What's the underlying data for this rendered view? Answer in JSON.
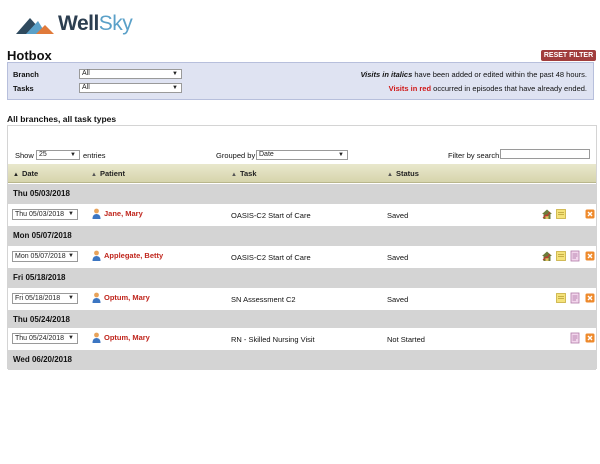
{
  "brand": {
    "part1": "Well",
    "part2": "Sky"
  },
  "page": {
    "title": "Hotbox",
    "reset_label": "RESET FILTER"
  },
  "filters": {
    "branch_label": "Branch",
    "branch_value": "All",
    "tasks_label": "Tasks",
    "tasks_value": "All",
    "italic_note_strong": "Visits in italics",
    "italic_note_rest": " have been added or edited within the past 48 hours.",
    "red_note_strong": "Visits in red",
    "red_note_rest": " occurred in episodes that have already ended."
  },
  "section_title": "All branches, all task types",
  "controls": {
    "show_label": "Show",
    "show_value": "25",
    "entries_label": "entries",
    "grouped_label": "Grouped by",
    "grouped_value": "Date",
    "search_label": "Filter by search:"
  },
  "table": {
    "columns": [
      "Date",
      "Patient",
      "Task",
      "Status"
    ],
    "groups": [
      {
        "label": "Thu 05/03/2018",
        "row": {
          "date": "Thu 05/03/2018",
          "patient": "Jane, Mary",
          "task": "OASIS-C2 Start of Care",
          "status": "Saved",
          "icons": [
            "home-icon",
            "note-icon",
            "cancel-icon"
          ]
        }
      },
      {
        "label": "Mon 05/07/2018",
        "row": {
          "date": "Mon 05/07/2018",
          "patient": "Applegate, Betty",
          "task": "OASIS-C2 Start of Care",
          "status": "Saved",
          "icons": [
            "home-icon",
            "note-icon",
            "document-icon",
            "cancel-icon"
          ]
        }
      },
      {
        "label": "Fri 05/18/2018",
        "row": {
          "date": "Fri 05/18/2018",
          "patient": "Optum, Mary",
          "task": "SN Assessment C2",
          "status": "Saved",
          "icons": [
            "note-icon",
            "document-icon",
            "cancel-icon"
          ]
        }
      },
      {
        "label": "Thu 05/24/2018",
        "row": {
          "date": "Thu 05/24/2018",
          "patient": "Optum, Mary",
          "task": "RN - Skilled Nursing Visit",
          "status": "Not Started",
          "icons": [
            "document-icon",
            "cancel-icon"
          ]
        }
      },
      {
        "label": "Wed 06/20/2018"
      }
    ]
  },
  "colors": {
    "accent_red": "#c0261d",
    "reset_button": "#a13d3d",
    "filter_panel": "#dfe3f2",
    "header_band": "#d6d4ac"
  }
}
